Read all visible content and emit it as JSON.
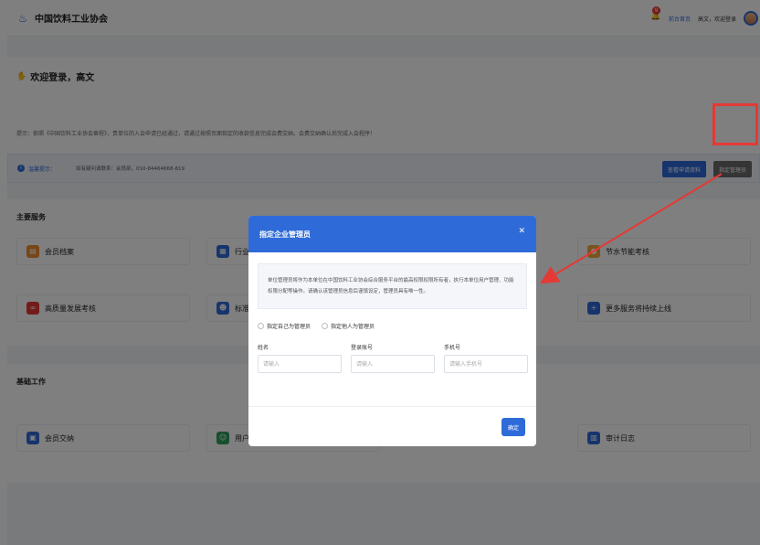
{
  "topbar": {
    "app_title": "中国饮料工业协会",
    "bell_count": "9",
    "front_link": "前台首页",
    "user_text": "高文，欢迎登录"
  },
  "welcome": {
    "title": "欢迎登录，高文",
    "tip": "提示：依照《中国饮料工业协会章程》，贵单位的入会申请已经通过，请通过按照页面指定的收款信息完成会费交纳。会费交纳确认后完成入会程序！"
  },
  "notice": {
    "label": "温馨提示：",
    "text": "如有疑问请联系：会员部，010-84464668-819",
    "view_button": "查看申请资料",
    "assign_button": "指定管理员"
  },
  "main_section": {
    "title": "主要服务",
    "tiles": [
      {
        "label": "会员档案",
        "icon": "archive-icon",
        "color": "#f08c2e"
      },
      {
        "label": "行业",
        "icon": "industry-icon",
        "color": "#2f6bd8"
      },
      {
        "label": "节水节能考核",
        "icon": "water-drop-icon",
        "color": "#f2a93b"
      },
      {
        "label": "高质量发展考核",
        "icon": "infinity-icon",
        "color": "#e53935"
      },
      {
        "label": "标准",
        "icon": "person-icon",
        "color": "#2f6bd8"
      },
      {
        "label": "更多服务将持续上线",
        "icon": "plus-icon",
        "color": "#2f6bd8"
      }
    ]
  },
  "base_section": {
    "title": "基础工作",
    "tiles": [
      {
        "label": "会员交纳",
        "icon": "document-icon",
        "color": "#2f6bd8"
      },
      {
        "label": "用户",
        "icon": "user-icon",
        "color": "#2e9e5b"
      },
      {
        "label": "审计日志",
        "icon": "log-icon",
        "color": "#2f6bd8"
      }
    ]
  },
  "modal": {
    "title": "指定企业管理员",
    "description": "单位管理员将作为本单位在中国饮料工业协会综合服务平台的最高权限权限所有者，执行本单位用户管理、功能权限分配等操作。请确认该管理员信息后谨慎设定，管理员具有唯一性。",
    "radio_self": "指定自己为管理员",
    "radio_other": "指定他人为管理员",
    "fields": {
      "name_label": "姓名",
      "name_placeholder": "请输入",
      "account_label": "登录账号",
      "account_placeholder": "请输入",
      "phone_label": "手机号",
      "phone_placeholder": "请输入手机号"
    },
    "confirm_button": "确定"
  },
  "colors": {
    "primary": "#2f6bd8",
    "highlight": "#e53935"
  }
}
